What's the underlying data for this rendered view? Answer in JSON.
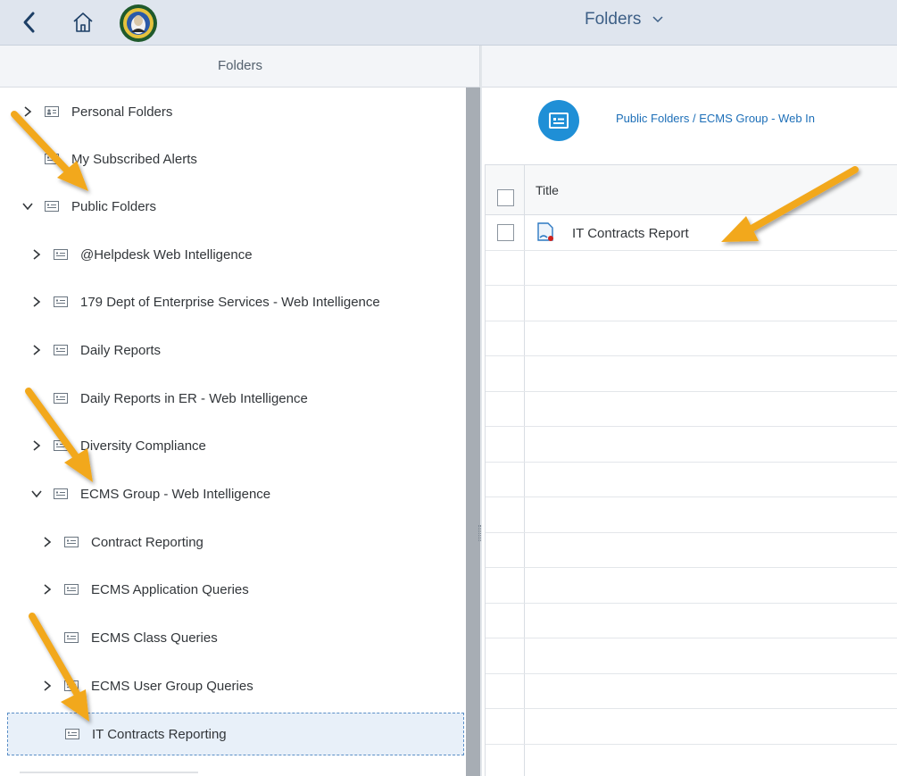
{
  "shell": {
    "title": "Folders",
    "colors": {
      "bar": "#dfe5ee",
      "title": "#3d5f86"
    },
    "icons": [
      "back-arrow-icon",
      "home-icon",
      "state-seal-logo",
      "chevron-down-icon"
    ]
  },
  "left_panel": {
    "title": "Folders",
    "tree": [
      {
        "label": "Personal Folders",
        "state": "collapsed",
        "icon": "personal-folder-icon"
      },
      {
        "label": "My Subscribed Alerts",
        "state": "leaf",
        "icon": "folder-icon"
      },
      {
        "label": "Public Folders",
        "state": "expanded",
        "icon": "folder-icon"
      },
      {
        "label": "@Helpdesk Web Intelligence",
        "state": "collapsed",
        "icon": "folder-icon"
      },
      {
        "label": "179 Dept of Enterprise Services - Web Intelligence",
        "state": "collapsed",
        "icon": "folder-icon"
      },
      {
        "label": "Daily Reports",
        "state": "collapsed",
        "icon": "folder-icon"
      },
      {
        "label": "Daily Reports in ER - Web Intelligence",
        "state": "leaf",
        "icon": "folder-icon"
      },
      {
        "label": "Diversity Compliance",
        "state": "collapsed",
        "icon": "folder-icon"
      },
      {
        "label": "ECMS Group - Web Intelligence",
        "state": "expanded",
        "icon": "folder-icon"
      },
      {
        "label": "Contract Reporting",
        "state": "collapsed",
        "icon": "folder-icon"
      },
      {
        "label": "ECMS Application Queries",
        "state": "collapsed",
        "icon": "folder-icon"
      },
      {
        "label": "ECMS Class Queries",
        "state": "leaf",
        "icon": "folder-icon"
      },
      {
        "label": "ECMS User Group Queries",
        "state": "collapsed",
        "icon": "folder-icon"
      },
      {
        "label": "IT Contracts Reporting",
        "state": "leaf",
        "selected": true,
        "icon": "folder-icon"
      }
    ]
  },
  "content": {
    "breadcrumb": "Public Folders / ECMS Group - Web In",
    "table": {
      "columns": [
        "Title"
      ],
      "rows": [
        {
          "title": "IT Contracts Report",
          "icon": "webi-document-icon"
        }
      ]
    },
    "colors": {
      "accent": "#1f8fd6",
      "link": "#1d6fb8"
    }
  },
  "annotations": {
    "arrow_color": "#f2a81d"
  }
}
